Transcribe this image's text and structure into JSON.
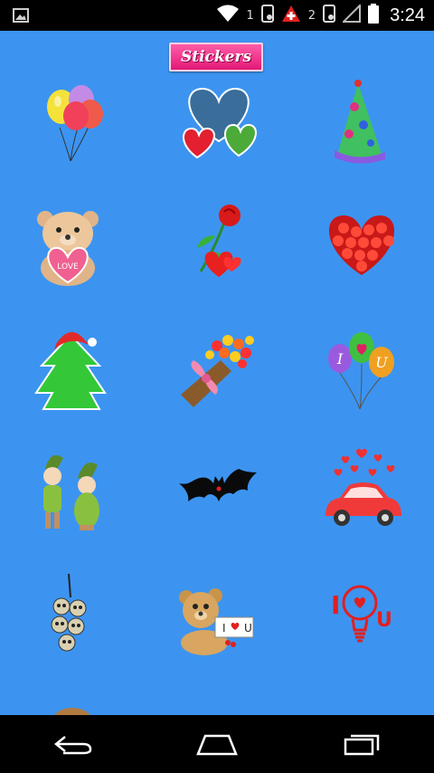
{
  "status_bar": {
    "sim1_label": "1",
    "sim2_label": "2",
    "time": "3:24"
  },
  "header": {
    "stickers_label": "Stickers"
  },
  "stickers": [
    "balloons-icon",
    "hearts-icon",
    "party-hat-icon",
    "teddy-bear-love-icon",
    "rose-hearts-icon",
    "rose-heart-icon",
    "christmas-tree-icon",
    "flower-bouquet-icon",
    "i-love-u-balloons-icon",
    "elf-dolls-icon",
    "bat-icon",
    "love-car-icon",
    "hanging-skulls-icon",
    "teddy-bear-sign-icon",
    "i-love-u-bulb-icon"
  ],
  "sticker_texts": {
    "love_label": "LOVE",
    "i_label": "I",
    "u_label": "U",
    "sign_i_label": "I",
    "sign_u_label": "U",
    "bulb_i_label": "I",
    "bulb_u_label": "U"
  }
}
